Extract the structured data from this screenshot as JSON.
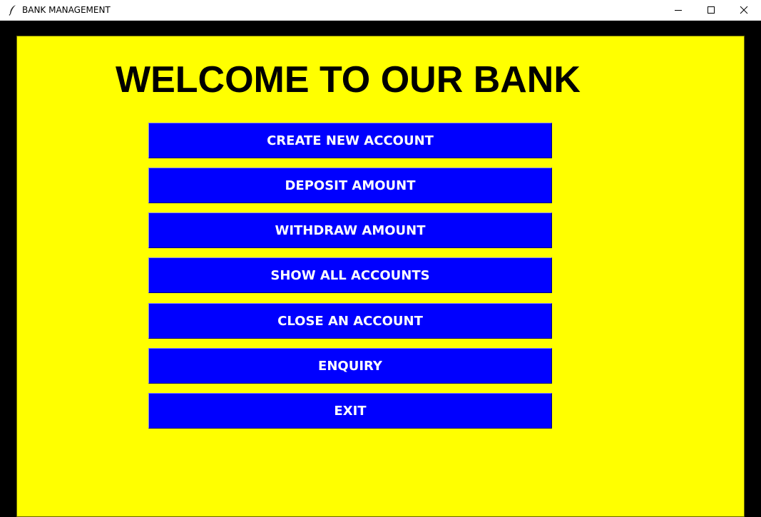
{
  "window": {
    "title": "BANK MANAGEMENT",
    "icon": "feather-icon",
    "controls": [
      "minimize-icon",
      "maximize-icon",
      "close-icon"
    ]
  },
  "main": {
    "heading": "WELCOME TO OUR BANK",
    "buttons": [
      {
        "label": "CREATE NEW ACCOUNT"
      },
      {
        "label": "DEPOSIT AMOUNT"
      },
      {
        "label": "WITHDRAW AMOUNT"
      },
      {
        "label": "SHOW ALL ACCOUNTS"
      },
      {
        "label": "CLOSE AN ACCOUNT"
      },
      {
        "label": "ENQUIRY"
      },
      {
        "label": "EXIT"
      }
    ]
  },
  "colors": {
    "background": "#ffff00",
    "frame": "#000000",
    "button": "#0000ff",
    "button_text": "#ffffff",
    "heading_text": "#000000"
  }
}
